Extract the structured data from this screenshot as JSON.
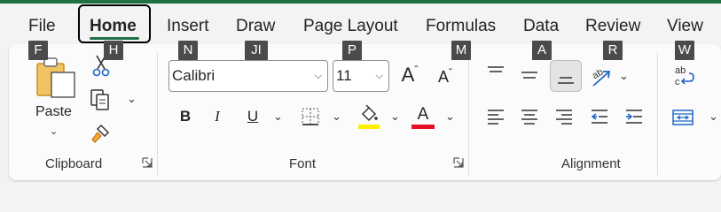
{
  "tabs": [
    {
      "label": "File"
    },
    {
      "label": "Home"
    },
    {
      "label": "Insert"
    },
    {
      "label": "Draw"
    },
    {
      "label": "Page Layout"
    },
    {
      "label": "Formulas"
    },
    {
      "label": "Data"
    },
    {
      "label": "Review"
    },
    {
      "label": "View"
    }
  ],
  "keytips": {
    "file": "F",
    "home": "H",
    "insert": "N",
    "draw": "JI",
    "page_layout": "P",
    "formulas": "M",
    "data": "A",
    "review": "R",
    "view": "W"
  },
  "clipboard": {
    "paste_label": "Paste",
    "group_label": "Clipboard"
  },
  "font": {
    "font_name": "Calibri",
    "font_size": "11",
    "bold_label": "B",
    "italic_label": "I",
    "underline_label": "U",
    "font_color_label": "A",
    "grow_label": "A",
    "shrink_label": "A",
    "highlight_color": "#ffee00",
    "font_color": "#e81123",
    "group_label": "Font"
  },
  "alignment": {
    "group_label": "Alignment"
  },
  "colors": {
    "accent": "#1e7145",
    "keytip_bg": "#4b4b4b",
    "wrap_icon": "#1e66c9"
  }
}
